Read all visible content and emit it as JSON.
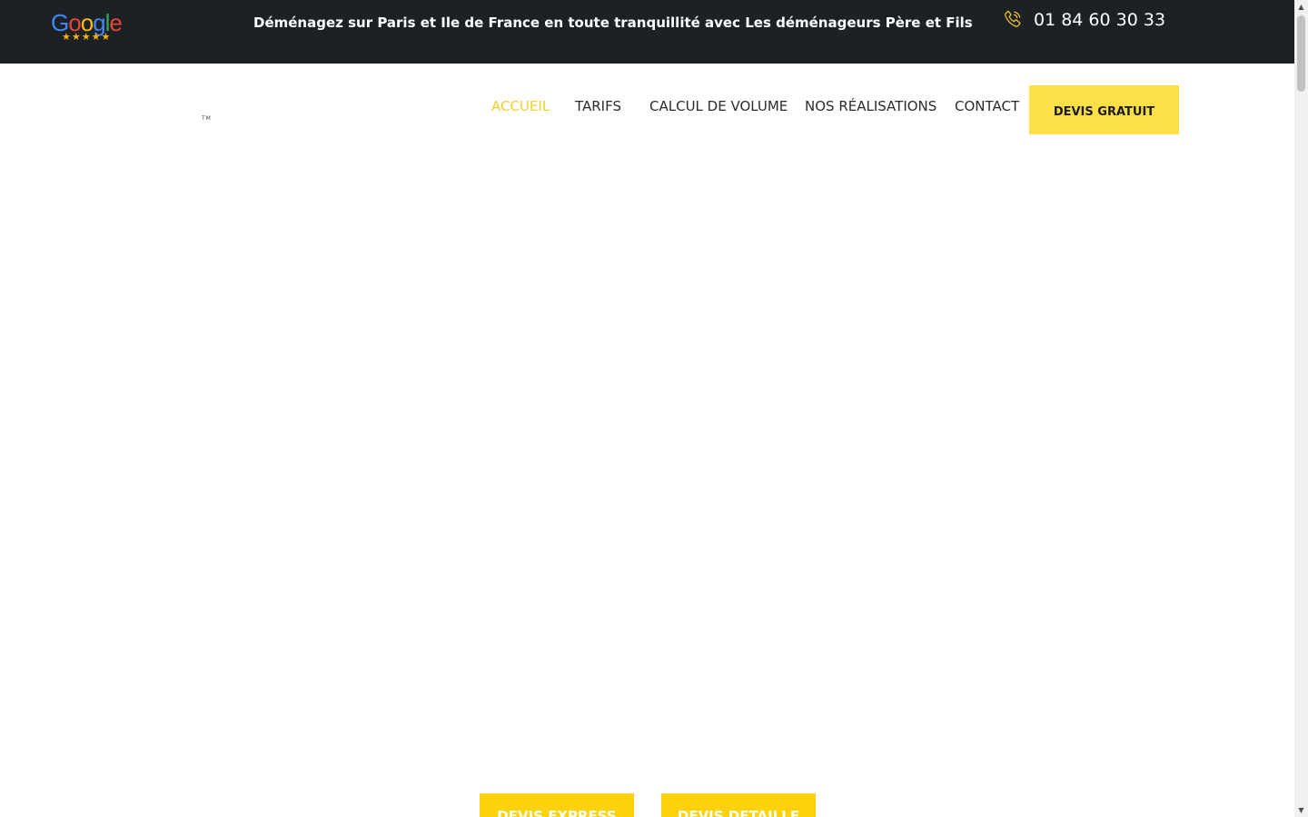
{
  "topbar": {
    "google_letters": [
      {
        "char": "G",
        "color": "#4285F4"
      },
      {
        "char": "o",
        "color": "#EA4335"
      },
      {
        "char": "o",
        "color": "#FBBC05"
      },
      {
        "char": "g",
        "color": "#4285F4"
      },
      {
        "char": "l",
        "color": "#34A853"
      },
      {
        "char": "e",
        "color": "#EA4335"
      }
    ],
    "rating_stars": "★★★★★",
    "tagline": "Déménagez sur Paris et Ile de France en toute tranquillité avec Les déménageurs Père et Fils",
    "phone_icon": "phone-icon",
    "phone_number": "01 84 60 30 33"
  },
  "header": {
    "logo_tm": "TM",
    "nav": [
      {
        "label": "ACCUEIL",
        "active": true
      },
      {
        "label": "TARIFS",
        "active": false
      },
      {
        "label": "CALCUL DE VOLUME",
        "active": false
      },
      {
        "label": "NOS RÉALISATIONS",
        "active": false
      },
      {
        "label": "CONTACT",
        "active": false
      }
    ],
    "cta_label": "DEVIS GRATUIT"
  },
  "hero": {
    "buttons": [
      {
        "label": "DEVIS EXPRESS"
      },
      {
        "label": "DEVIS DETAILLE"
      }
    ]
  },
  "colors": {
    "topbar_bg": "#1c2126",
    "accent_yellow": "#fde047",
    "cta_yellow": "#fcd20c",
    "nav_active": "#f2cf2a",
    "nav_text": "#2b2b2b"
  }
}
